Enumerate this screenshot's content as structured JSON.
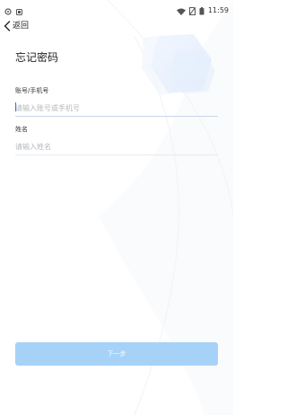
{
  "status_bar": {
    "time": "11:59",
    "left_icons": [
      "app-notification-icon",
      "sim-notification-icon"
    ],
    "right_icons": [
      "wifi-icon",
      "no-sim-icon",
      "battery-icon"
    ]
  },
  "header": {
    "back_label": "返回",
    "title": "忘记密码"
  },
  "form": {
    "account": {
      "label": "账号/手机号",
      "placeholder": "请输入账号或手机号",
      "value": ""
    },
    "name": {
      "label": "姓名",
      "placeholder": "请输入姓名",
      "value": ""
    }
  },
  "next_button": {
    "label": "下一步",
    "enabled": false
  },
  "colors": {
    "accent": "#3a78d8",
    "button_disabled": "#a6d2f8",
    "divider": "#e8eaee",
    "placeholder": "#b5b8bd"
  }
}
